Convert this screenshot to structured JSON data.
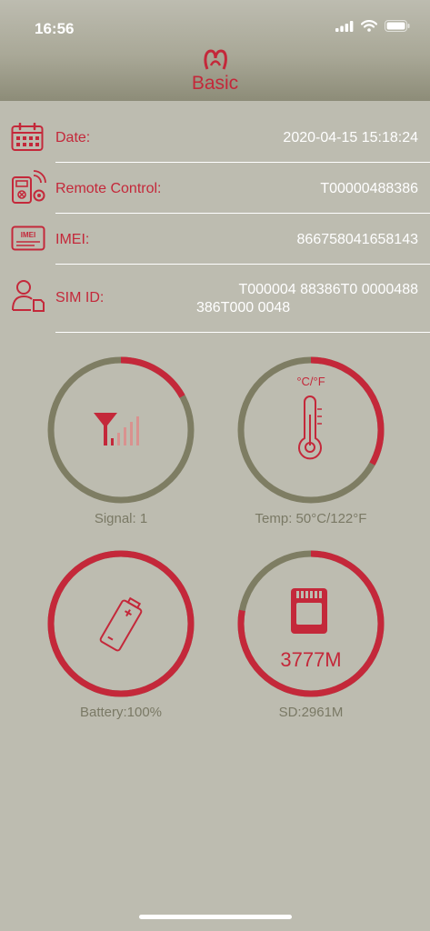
{
  "status": {
    "time": "16:56"
  },
  "header": {
    "title": "Basic"
  },
  "info": [
    {
      "label": "Date:",
      "value": "2020-04-15 15:18:24"
    },
    {
      "label": "Remote Control:",
      "value": "T00000488386"
    },
    {
      "label": "IMEI:",
      "value": "866758041658143"
    },
    {
      "label": "SIM ID:",
      "value_line1": "T000004 88386T0 0000488",
      "value_line2": "386T000 0048"
    }
  ],
  "icons": {
    "imei_badge": "IMEI",
    "temp_unit": "°C/°F"
  },
  "gauges": {
    "signal": {
      "caption": "Signal: 1",
      "fraction": 0.17
    },
    "temp": {
      "caption": "Temp: 50°C/122°F",
      "fraction": 0.33
    },
    "battery": {
      "caption": "Battery:100%",
      "fraction": 1.0
    },
    "sd": {
      "caption": "SD:2961M",
      "value": "3777M",
      "fraction": 0.78
    }
  },
  "colors": {
    "accent": "#c4283a",
    "track": "#7e7d63",
    "background": "#bdbcb0"
  }
}
